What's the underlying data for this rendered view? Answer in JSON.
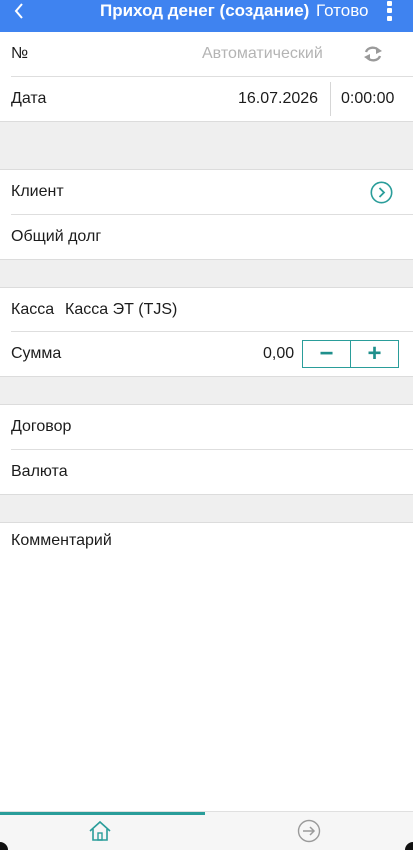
{
  "header": {
    "title": "Приход денег (создание)",
    "done_label": "Готово",
    "back_icon": "chevron-left-icon",
    "menu_icon": "more-vertical-icon",
    "color": "#3f83f0"
  },
  "form": {
    "number": {
      "label": "№",
      "placeholder": "Автоматический",
      "icon": "refresh-icon"
    },
    "date": {
      "label": "Дата",
      "date_value": "16.07.2026",
      "time_value": "0:00:00"
    },
    "client": {
      "label": "Клиент",
      "icon": "chevron-right-circle-icon"
    },
    "total_debt": {
      "label": "Общий долг"
    },
    "cash": {
      "label": "Касса",
      "value": "Касса ЭТ (TJS)"
    },
    "amount": {
      "label": "Сумма",
      "value": "0,00",
      "minus": "−",
      "plus": "+"
    },
    "contract": {
      "label": "Договор"
    },
    "currency": {
      "label": "Валюта"
    },
    "comment": {
      "label": "Комментарий"
    }
  },
  "bottom_nav": {
    "tabs": [
      {
        "icon": "home-icon",
        "active": true
      },
      {
        "icon": "arrow-right-circle-icon",
        "active": false
      }
    ],
    "accent": "#2a9d9a"
  }
}
